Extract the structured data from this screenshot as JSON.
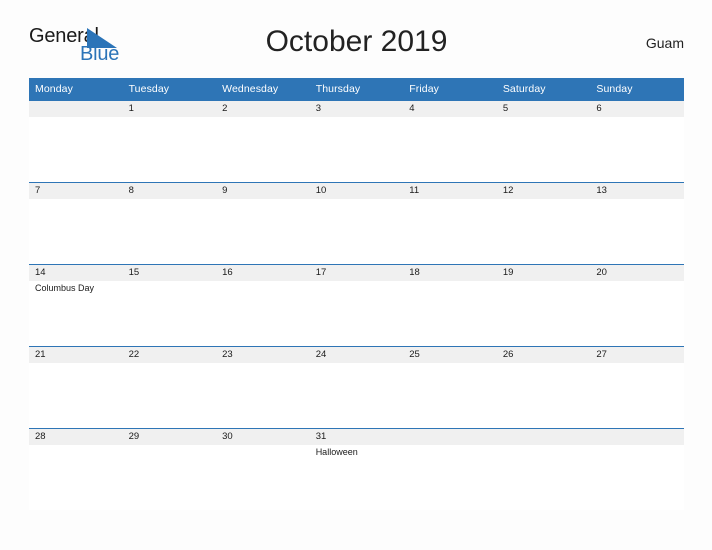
{
  "brand": {
    "name_top": "General",
    "name_bottom": "Blue",
    "triangle_color": "#2b74b8",
    "text_color": "#1a1a1a"
  },
  "header": {
    "title": "October 2019",
    "locale": "Guam"
  },
  "theme": {
    "header_blue": "#2e75b6",
    "date_band_gray": "#f0f0f0",
    "page_background": "#fdfdfd",
    "text": "#1a1a1a"
  },
  "calendar": {
    "month": "October",
    "year": "2019",
    "weekday_headers": [
      "Monday",
      "Tuesday",
      "Wednesday",
      "Thursday",
      "Friday",
      "Saturday",
      "Sunday"
    ],
    "weeks": [
      [
        {
          "date": "",
          "events": []
        },
        {
          "date": "1",
          "events": []
        },
        {
          "date": "2",
          "events": []
        },
        {
          "date": "3",
          "events": []
        },
        {
          "date": "4",
          "events": []
        },
        {
          "date": "5",
          "events": []
        },
        {
          "date": "6",
          "events": []
        }
      ],
      [
        {
          "date": "7",
          "events": []
        },
        {
          "date": "8",
          "events": []
        },
        {
          "date": "9",
          "events": []
        },
        {
          "date": "10",
          "events": []
        },
        {
          "date": "11",
          "events": []
        },
        {
          "date": "12",
          "events": []
        },
        {
          "date": "13",
          "events": []
        }
      ],
      [
        {
          "date": "14",
          "events": [
            "Columbus Day"
          ]
        },
        {
          "date": "15",
          "events": []
        },
        {
          "date": "16",
          "events": []
        },
        {
          "date": "17",
          "events": []
        },
        {
          "date": "18",
          "events": []
        },
        {
          "date": "19",
          "events": []
        },
        {
          "date": "20",
          "events": []
        }
      ],
      [
        {
          "date": "21",
          "events": []
        },
        {
          "date": "22",
          "events": []
        },
        {
          "date": "23",
          "events": []
        },
        {
          "date": "24",
          "events": []
        },
        {
          "date": "25",
          "events": []
        },
        {
          "date": "26",
          "events": []
        },
        {
          "date": "27",
          "events": []
        }
      ],
      [
        {
          "date": "28",
          "events": []
        },
        {
          "date": "29",
          "events": []
        },
        {
          "date": "30",
          "events": []
        },
        {
          "date": "31",
          "events": [
            "Halloween"
          ]
        },
        {
          "date": "",
          "events": []
        },
        {
          "date": "",
          "events": []
        },
        {
          "date": "",
          "events": []
        }
      ]
    ]
  }
}
